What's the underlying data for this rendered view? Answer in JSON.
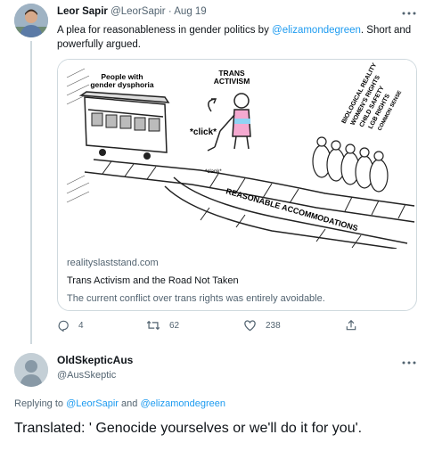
{
  "tweet": {
    "author_name": "Leor Sapir",
    "author_handle": "@LeorSapir",
    "separator": "·",
    "date": "Aug 19",
    "text_prefix": "A plea for reasonableness in gender politics by ",
    "text_mention": "@elizamondegreen",
    "text_suffix": ". Short and powerfully argued.",
    "card": {
      "image": {
        "label_left": "People with gender dysphoria",
        "label_center": "TRANS ACTIVISM",
        "click_text": "*click*",
        "clank_text": "*clank*",
        "track_label": "REASONABLE ACCOMMODATIONS",
        "group_labels": [
          "BIOLOGICAL REALITY",
          "WOMEN'S RIGHTS",
          "CHILD SAFETY",
          "LGB RIGHTS",
          "COMMON SENSE"
        ]
      },
      "domain": "realityslaststand.com",
      "title": "Trans Activism and the Road Not Taken",
      "description": "The current conflict over trans rights was entirely avoidable."
    },
    "actions": {
      "replies": "4",
      "retweets": "62",
      "likes": "238"
    }
  },
  "reply": {
    "author_name": "OldSkepticAus",
    "author_handle": "@AusSkeptic",
    "replying_to_prefix": "Replying to ",
    "replying_to_user1": "@LeorSapir",
    "replying_to_and": " and ",
    "replying_to_user2": "@elizamondegreen",
    "text": "Translated: ' Genocide yourselves or we'll do it for you'."
  },
  "colors": {
    "link": "#1d9bf0",
    "secondary_text": "#536471",
    "border": "#cfd9de"
  },
  "icons": [
    "more-icon",
    "reply-icon",
    "retweet-icon",
    "like-icon",
    "share-icon",
    "default-avatar-icon"
  ]
}
